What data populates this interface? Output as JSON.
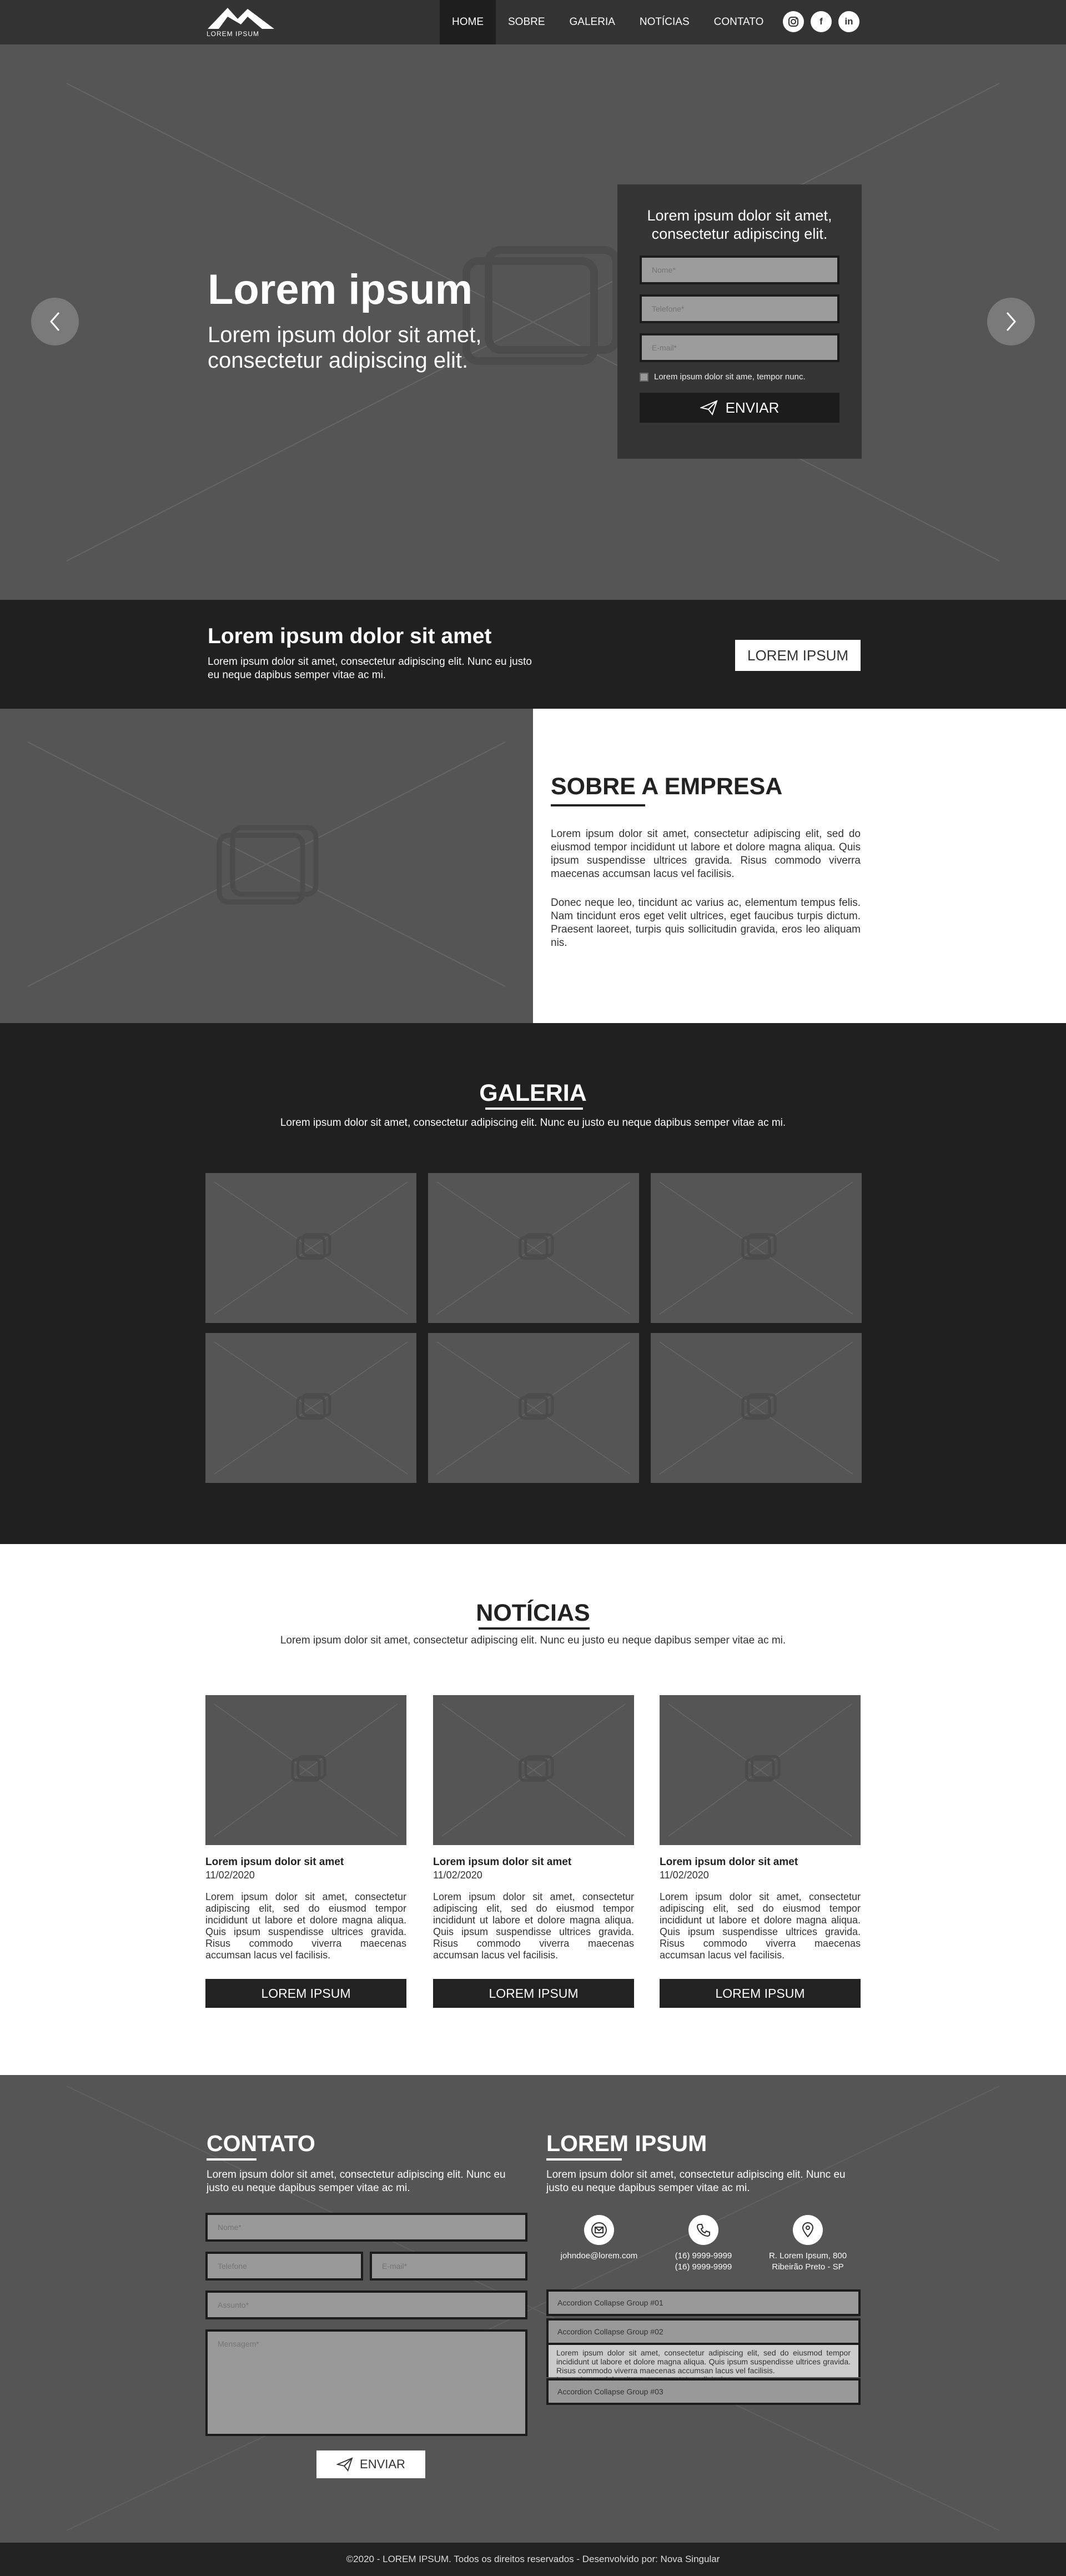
{
  "header": {
    "logo_text": "LOREM IPSUM",
    "nav": [
      {
        "label": "HOME",
        "active": true
      },
      {
        "label": "SOBRE"
      },
      {
        "label": "GALERIA"
      },
      {
        "label": "NOTÍCIAS"
      },
      {
        "label": "CONTATO"
      }
    ],
    "social": [
      "instagram-icon",
      "facebook-icon",
      "linkedin-icon"
    ]
  },
  "hero": {
    "title": "Lorem ipsum",
    "subtitle": "Lorem ipsum dolor sit amet, consectetur adipiscing elit.",
    "form": {
      "title": "Lorem ipsum dolor sit amet, consectetur adipiscing elit.",
      "name_placeholder": "Nome*",
      "phone_placeholder": "Telefone*",
      "email_placeholder": "E-mail*",
      "checkbox_label": "Lorem ipsum dolor sit ame, tempor nunc.",
      "submit_label": "ENVIAR"
    }
  },
  "cta": {
    "title": "Lorem ipsum dolor sit amet",
    "text": "Lorem ipsum dolor sit amet, consectetur adipiscing elit. Nunc eu justo eu neque dapibus semper vitae ac mi.",
    "button": "LOREM IPSUM"
  },
  "about": {
    "title": "SOBRE A EMPRESA",
    "p1": "Lorem ipsum dolor sit amet, consectetur adipiscing elit, sed do eiusmod tempor incididunt ut labore et dolore magna aliqua. Quis ipsum suspendisse ultrices gravida. Risus commodo viverra maecenas accumsan lacus vel facilisis.",
    "p2": "Donec neque leo, tincidunt ac varius ac, elementum tempus felis. Nam tincidunt eros eget velit ultrices, eget faucibus turpis dictum. Praesent laoreet, turpis quis sollicitudin gravida, eros leo aliquam nis."
  },
  "gallery": {
    "title": "GALERIA",
    "subtitle": "Lorem ipsum dolor sit amet, consectetur adipiscing elit. Nunc eu justo eu neque dapibus semper vitae ac mi."
  },
  "news": {
    "title": "NOTÍCIAS",
    "subtitle": "Lorem ipsum dolor sit amet, consectetur adipiscing elit. Nunc eu justo eu neque dapibus semper vitae ac mi.",
    "items": [
      {
        "title": "Lorem ipsum dolor sit amet",
        "date": "11/02/2020",
        "text": "Lorem ipsum dolor sit amet, consectetur adipiscing elit, sed do eiusmod tempor incididunt ut labore et dolore magna aliqua. Quis ipsum suspendisse ultrices gravida. Risus commodo viverra maecenas accumsan lacus vel facilisis.",
        "button": "LOREM IPSUM"
      },
      {
        "title": "Lorem ipsum dolor sit amet",
        "date": "11/02/2020",
        "text": "Lorem ipsum dolor sit amet, consectetur adipiscing elit, sed do eiusmod tempor incididunt ut labore et dolore magna aliqua. Quis ipsum suspendisse ultrices gravida. Risus commodo viverra maecenas accumsan lacus vel facilisis.",
        "button": "LOREM IPSUM"
      },
      {
        "title": "Lorem ipsum dolor sit amet",
        "date": "11/02/2020",
        "text": "Lorem ipsum dolor sit amet, consectetur adipiscing elit, sed do eiusmod tempor incididunt ut labore et dolore magna aliqua. Quis ipsum suspendisse ultrices gravida. Risus commodo viverra maecenas accumsan lacus vel facilisis.",
        "button": "LOREM IPSUM"
      }
    ]
  },
  "contact": {
    "title": "CONTATO",
    "subtitle": "Lorem ipsum dolor sit amet, consectetur adipiscing elit. Nunc eu justo eu neque dapibus semper vitae ac mi.",
    "name_placeholder": "Nome*",
    "phone_placeholder": "Telefone",
    "email_placeholder": "E-mail*",
    "subject_placeholder": "Assunto*",
    "message_placeholder": "Mensagem*",
    "submit_label": "ENVIAR"
  },
  "company": {
    "title": "LOREM IPSUM",
    "subtitle": "Lorem ipsum dolor sit amet, consectetur adipiscing elit. Nunc eu justo eu neque dapibus semper vitae ac mi.",
    "email": "johndoe@lorem.com",
    "phone1": "(16) 9999-9999",
    "phone2": "(16) 9999-9999",
    "address1": "R. Lorem Ipsum, 800",
    "address2": "Ribeirão Preto - SP",
    "accordion": {
      "group1": "Accordion Collapse Group #01",
      "group2": "Accordion Collapse Group #02",
      "group2_body": "Lorem ipsum dolor sit amet, consectetur adipiscing elit, sed do eiusmod tempor incididunt ut labore et dolore magna aliqua. Quis ipsum suspendisse ultrices gravida. Risus commodo viverra maecenas accumsan lacus vel facilisis.",
      "group2_body2": "Lorem ipsum dolor sit amet, consectetur adipiscing.",
      "group3": "Accordion Collapse Group #03"
    }
  },
  "footer": {
    "text": "©2020 - LOREM IPSUM. Todos os direitos reservados - Desenvolvido por: Nova Singular"
  }
}
